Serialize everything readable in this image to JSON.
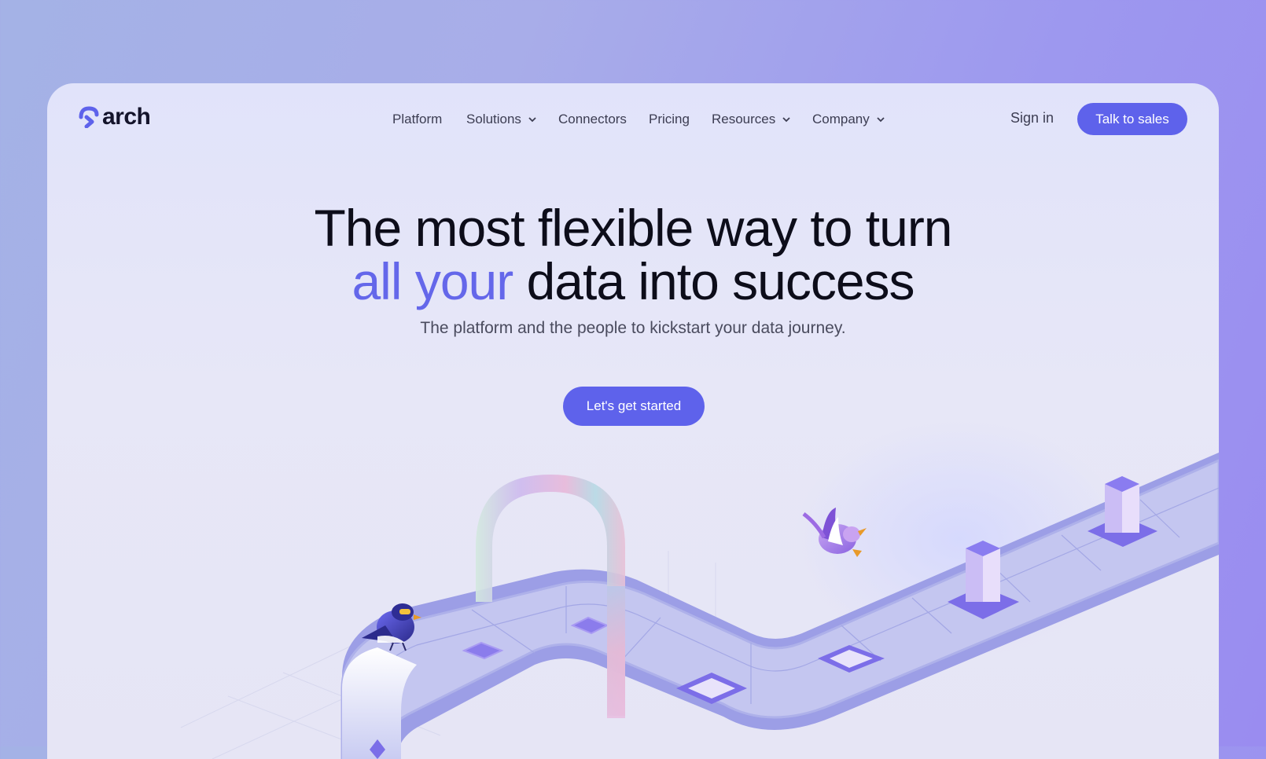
{
  "brand": {
    "name": "arch",
    "color": "#5e62eb"
  },
  "nav": {
    "items": [
      {
        "label": "Platform",
        "has_dropdown": false
      },
      {
        "label": "Solutions",
        "has_dropdown": true
      },
      {
        "label": "Connectors",
        "has_dropdown": false
      },
      {
        "label": "Pricing",
        "has_dropdown": false
      },
      {
        "label": "Resources",
        "has_dropdown": true
      },
      {
        "label": "Company",
        "has_dropdown": true
      }
    ],
    "signin_label": "Sign in",
    "talk_to_sales_label": "Talk to sales"
  },
  "hero": {
    "headline_line1": "The most flexible way to turn",
    "headline_accent": "all your",
    "headline_rest": " data into success",
    "subtitle": "The platform and the people to kickstart your data journey.",
    "cta_label": "Let's get started"
  },
  "colors": {
    "accent": "#6467ea",
    "button": "#5e62eb",
    "text_dark": "#0d0d1a",
    "text_muted": "#4a4b5e"
  }
}
